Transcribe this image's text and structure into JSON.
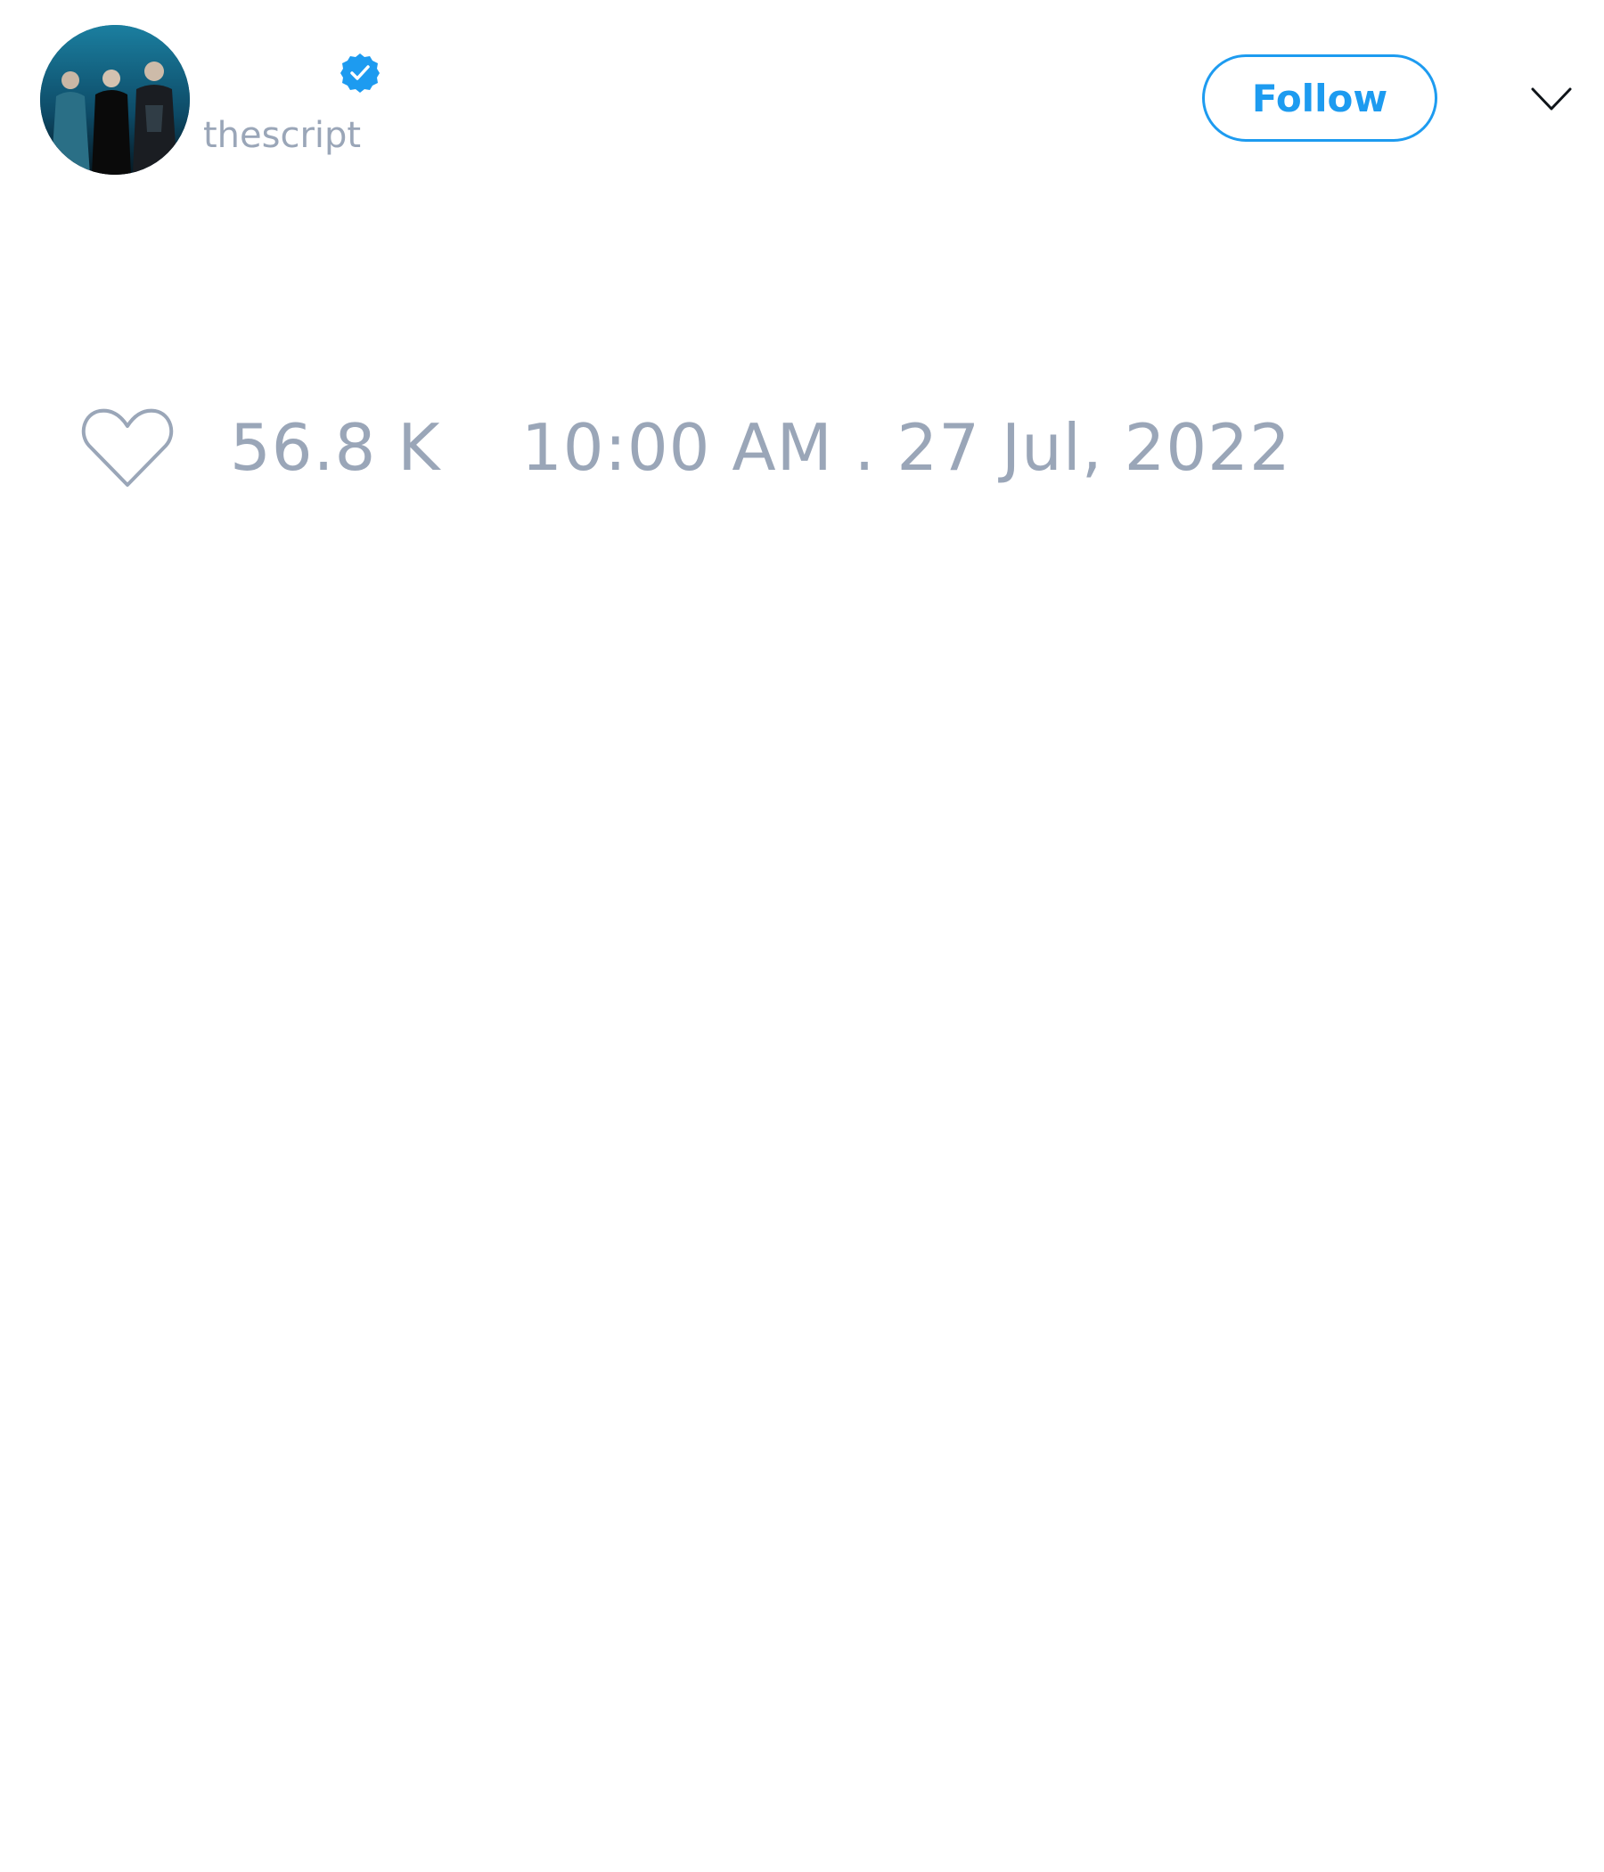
{
  "author": {
    "display_name": "",
    "handle": "thescript",
    "verified": true,
    "avatar": "band-photo-avatar"
  },
  "header": {
    "follow_label": "Follow",
    "more_icon": "chevron-down-icon"
  },
  "stats": {
    "like_icon": "heart-icon",
    "like_count": "56.8 K",
    "timestamp": "10:00 AM . 27 Jul, 2022"
  },
  "colors": {
    "accent": "#1d9bf0",
    "muted_text": "#9aa6b8",
    "background": "#ffffff"
  }
}
